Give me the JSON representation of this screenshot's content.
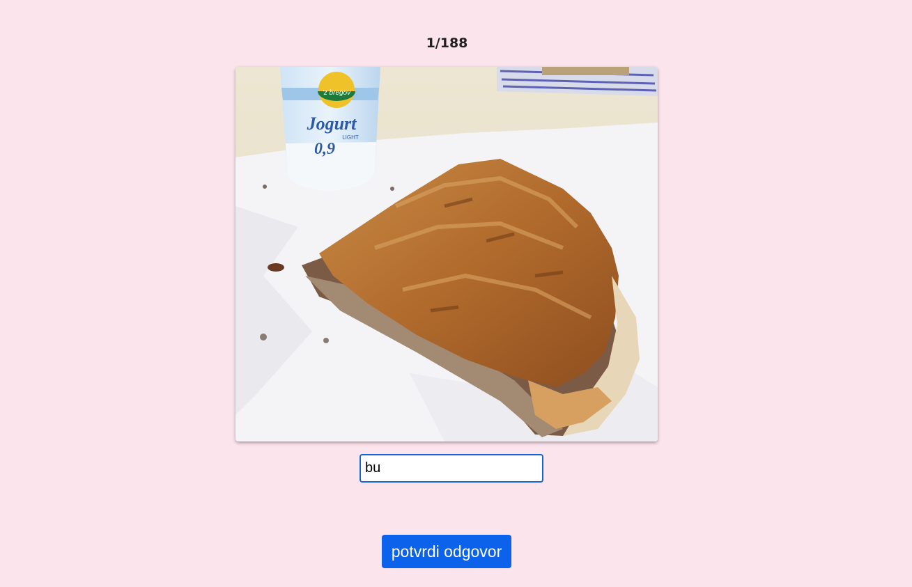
{
  "quiz": {
    "progress_text": "1/188",
    "answer_value": "bu",
    "submit_label": "potvrdi odgovor"
  },
  "photo": {
    "cup_brand": "'z bregov",
    "cup_product": "Jogurt",
    "cup_variant": "LIGHT",
    "cup_fat": "0,9"
  }
}
